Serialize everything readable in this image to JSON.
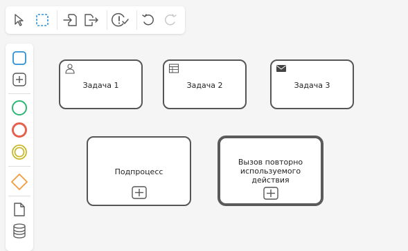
{
  "toolbar": {
    "items": [
      {
        "name": "select-tool-icon"
      },
      {
        "name": "marquee-select-tool-icon"
      },
      {
        "name": "import-icon"
      },
      {
        "name": "export-icon"
      },
      {
        "name": "validate-icon"
      },
      {
        "name": "undo-icon"
      },
      {
        "name": "redo-icon",
        "disabled": true
      }
    ]
  },
  "palette": {
    "items": [
      {
        "name": "task-shape-icon"
      },
      {
        "name": "subprocess-shape-icon"
      },
      {
        "name": "start-event-icon",
        "color": "#2bb673"
      },
      {
        "name": "end-event-icon",
        "color": "#e8604c"
      },
      {
        "name": "intermediate-event-icon",
        "color": "#c9b82a"
      },
      {
        "name": "gateway-icon",
        "color": "#f39c3d"
      },
      {
        "name": "data-object-icon"
      },
      {
        "name": "data-store-icon"
      }
    ]
  },
  "colors": {
    "accent_blue": "#2d8fd5",
    "node_border": "#555555",
    "canvas": "#f5f5f5"
  },
  "diagram": {
    "task1": {
      "label": "Задача 1",
      "icon": "user-icon"
    },
    "task2": {
      "label": "Задача 2",
      "icon": "table-icon"
    },
    "task3": {
      "label": "Задача 3",
      "icon": "envelope-icon"
    },
    "subprocess": {
      "label": "Подпроцесс",
      "marker": "expand-marker-icon"
    },
    "call_activity": {
      "label": "Вызов повторно используемого действия",
      "marker": "expand-marker-icon"
    }
  }
}
